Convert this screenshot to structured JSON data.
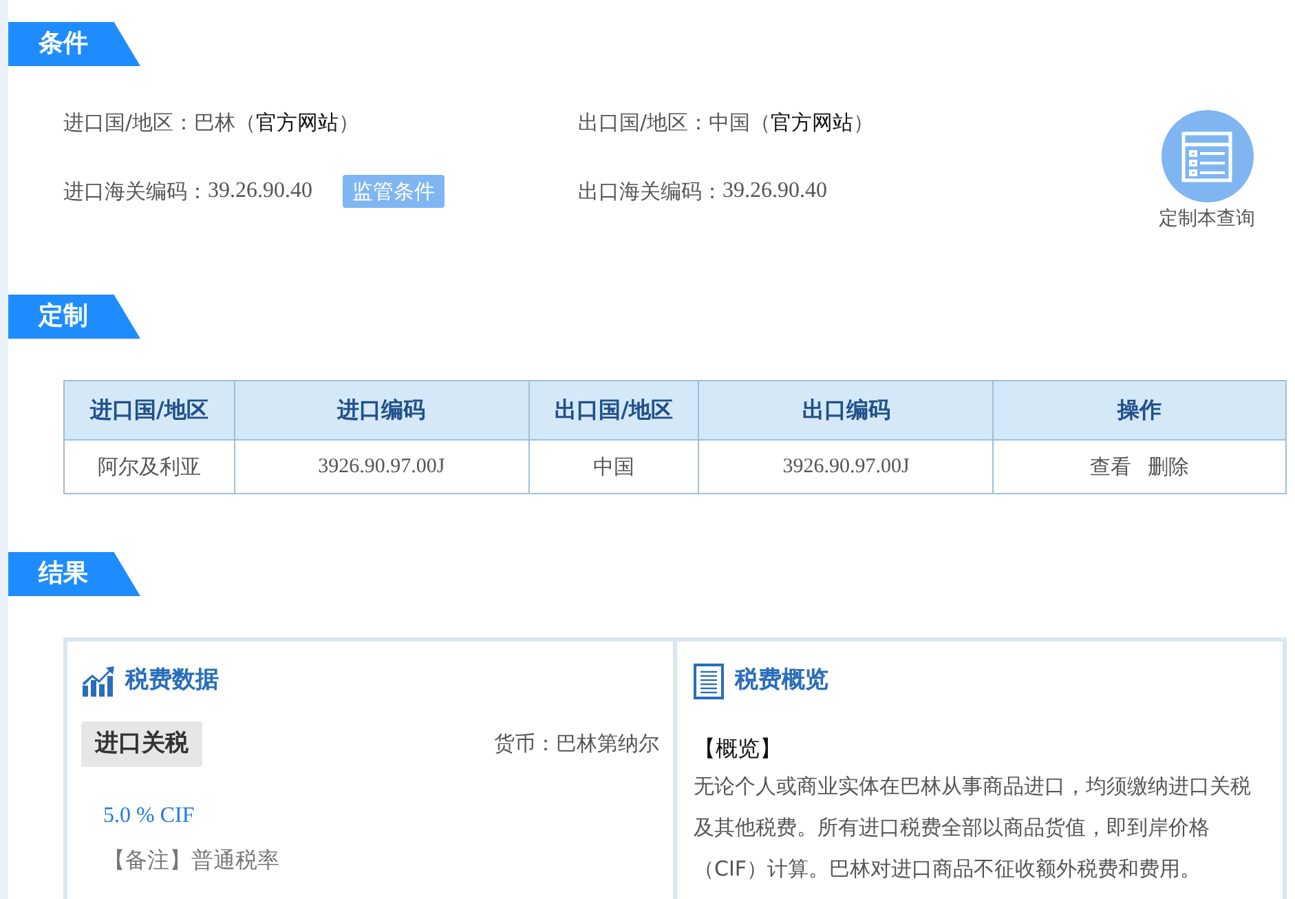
{
  "conditions": {
    "title": "条件",
    "fields": [
      {
        "label": "进口国/地区：",
        "value": "巴林（",
        "link": "官方网站",
        "suffix": "）"
      },
      {
        "label": "出口国/地区：",
        "value": "中国（",
        "link": "官方网站",
        "suffix": "）"
      },
      {
        "label": "进口海关编码：",
        "value": "39.26.90.40",
        "button": "监管条件"
      },
      {
        "label": "出口海关编码：",
        "value": "39.26.90.40"
      }
    ],
    "custom_query": {
      "label": "定制本查询"
    }
  },
  "custom": {
    "title": "定制",
    "table": {
      "columns": [
        "进口国/地区",
        "进口编码",
        "出口国/地区",
        "出口编码",
        "操作"
      ],
      "rows": [
        {
          "cells": [
            "阿尔及利亚",
            "3926.90.97.00J",
            "中国",
            "3926.90.97.00J"
          ],
          "actions": [
            "查看",
            "删除"
          ]
        }
      ]
    }
  },
  "results": {
    "title": "结果",
    "tax_data": {
      "title": "税费数据",
      "tag": "进口关税",
      "currency": "货币：巴林第纳尔",
      "rate": "5.0 % CIF",
      "note": "【备注】普通税率"
    },
    "overview": {
      "title": "税费概览",
      "heading": "【概览】",
      "text": "无论个人或商业实体在巴林从事商品进口，均须缴纳进口关税及其他税费。所有进口税费全部以商品货值，即到岸价格（CIF）计算。巴林对进口商品不征收额外税费和费用。"
    }
  }
}
